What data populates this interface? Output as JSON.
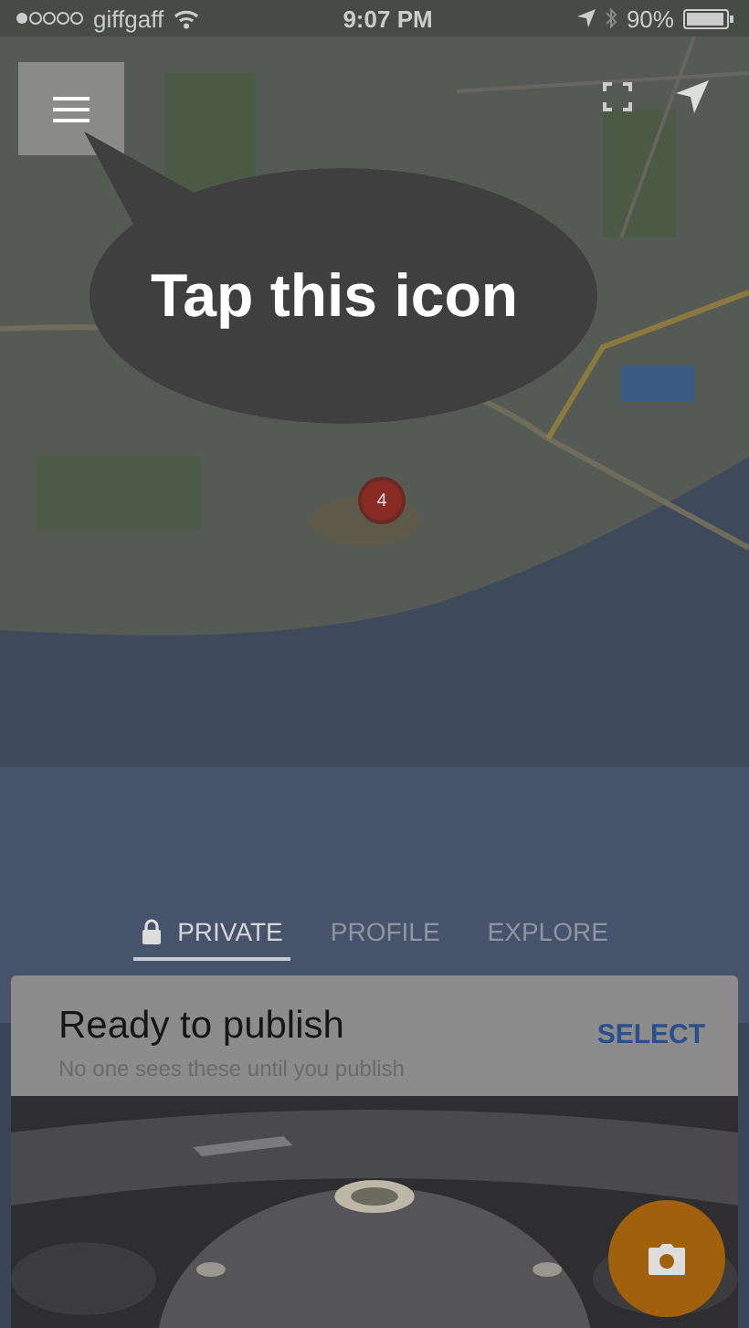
{
  "status_bar": {
    "carrier": "giffgaff",
    "time": "9:07 PM",
    "battery": "90%"
  },
  "tooltip": {
    "text": "Tap this icon"
  },
  "map": {
    "cluster_count": "4"
  },
  "tabs": [
    {
      "label": "PRIVATE",
      "selected": true,
      "locked": true
    },
    {
      "label": "PROFILE",
      "selected": false,
      "locked": false
    },
    {
      "label": "EXPLORE",
      "selected": false,
      "locked": false
    }
  ],
  "card": {
    "title": "Ready to publish",
    "subtitle": "No one sees these until you publish",
    "action": "SELECT"
  }
}
